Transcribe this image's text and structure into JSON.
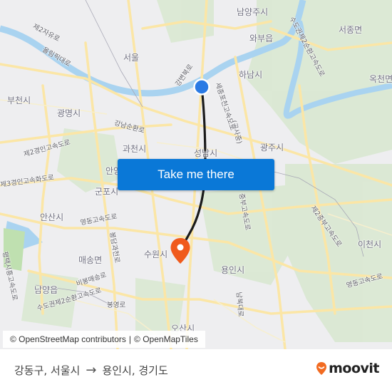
{
  "map": {
    "labels": {
      "seoul": "서울",
      "namyangju": "남양주시",
      "wabu": "와부읍",
      "seojong": "서종면",
      "hanam": "하남시",
      "okcheon": "옥천면",
      "bucheon": "부천시",
      "gwangmyeong": "광명시",
      "gwacheon": "과천시",
      "seongnam": "성남시",
      "gwangju": "광주시",
      "anyang": "안양",
      "gunpo": "군포시",
      "ansan": "안산시",
      "maesong": "매송면",
      "namyang": "남양읍",
      "suwon": "수원시",
      "yongin": "용인시",
      "icheon": "이천시",
      "osan": "오산시",
      "road_jayuro": "제2자유로",
      "road_olympic": "올림픽대로",
      "road_gangbyeon": "강변북로",
      "road_sejong": "세종포천고속도로",
      "road_gongsa": "(공사중)",
      "road_gangnam": "강남순환로",
      "road_gyeongin2": "제2경인고속도로",
      "road_gyeongin3": "제3경인고속화도로",
      "road_yeongdong": "영동고속도로",
      "road_gwacheon": "봉담과천로",
      "road_bibong": "비봉매송로",
      "road_sudogwon": "수도권제2순환고속도로",
      "road_bongyeong": "봉영로",
      "road_pyeongtaek": "평택시흥고속도로",
      "road_jungbu2": "중부고속도로",
      "road_nambuk": "남북대로",
      "road_sudogwon_north": "수도권제2순환고속도로",
      "road_jungbu_nae": "제2중부고속도로",
      "road_yeongdong_east": "영동고속도로"
    },
    "origin_marker": {
      "color": "#2a7ae4",
      "name": "강동구, 서울시"
    },
    "destination_marker": {
      "color": "#f05a1c",
      "name": "용인시, 경기도"
    },
    "route_line_color": "#1b1b1b"
  },
  "cta": {
    "label": "Take me there"
  },
  "attribution": {
    "osm": "© OpenStreetMap contributors",
    "separator": "|",
    "omt": "© OpenMapTiles"
  },
  "footer": {
    "origin": "강동구, 서울시",
    "arrow": "→",
    "destination": "용인시, 경기도",
    "brand": "moovit",
    "brand_color": "#f26b21"
  }
}
